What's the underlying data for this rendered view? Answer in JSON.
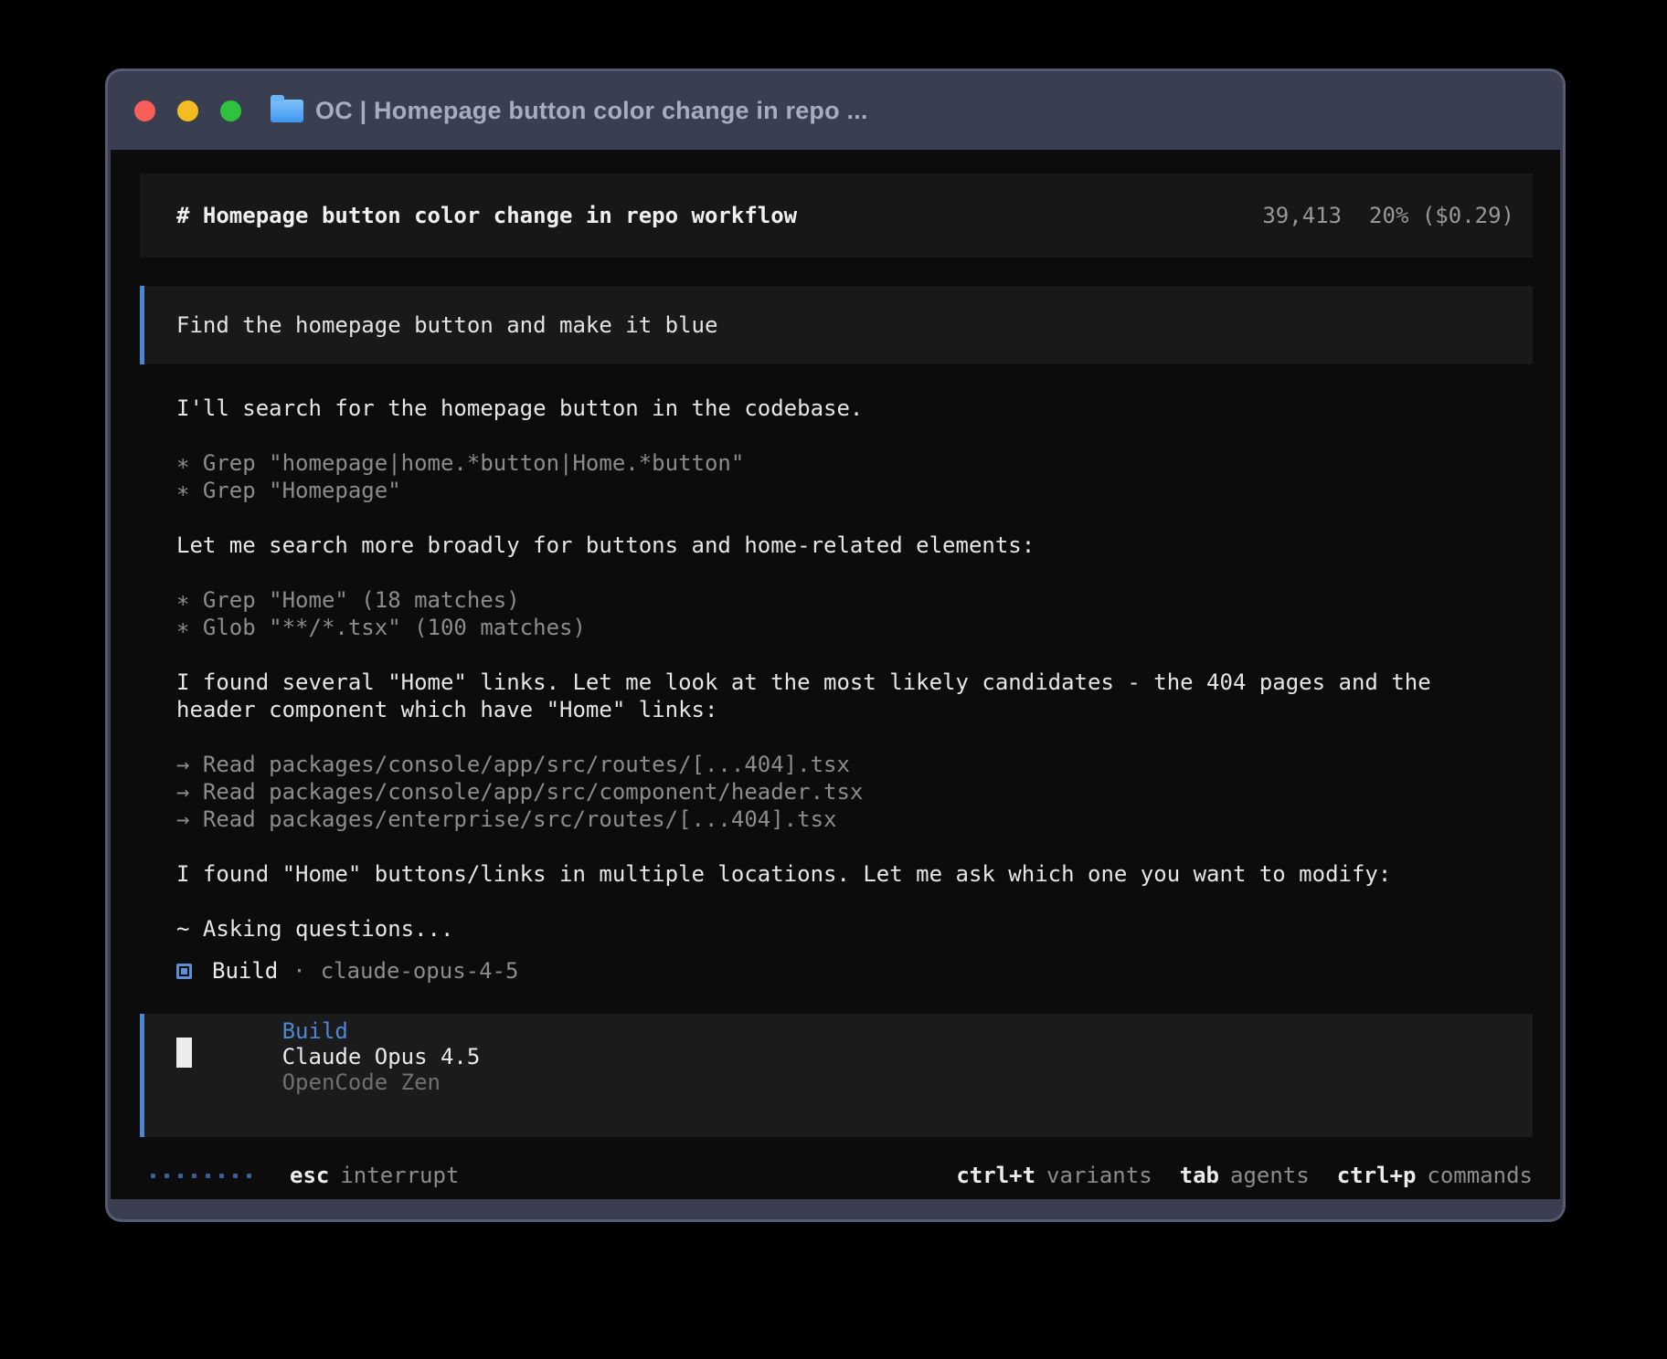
{
  "window": {
    "title": "OC | Homepage button color change in repo ..."
  },
  "header": {
    "title": "# Homepage button color change in repo workflow",
    "tokens": "39,413",
    "context": "20% ($0.29)"
  },
  "user_message": "Find the homepage button and make it blue",
  "conversation": [
    {
      "type": "text",
      "text": "I'll search for the homepage button in the codebase."
    },
    {
      "type": "blank"
    },
    {
      "type": "tool",
      "prefix": "∗",
      "text": "Grep \"homepage|home.*button|Home.*button\""
    },
    {
      "type": "tool",
      "prefix": "∗",
      "text": "Grep \"Homepage\""
    },
    {
      "type": "blank"
    },
    {
      "type": "text",
      "text": "Let me search more broadly for buttons and home-related elements:"
    },
    {
      "type": "blank"
    },
    {
      "type": "tool",
      "prefix": "∗",
      "text": "Grep \"Home\" (18 matches)"
    },
    {
      "type": "tool",
      "prefix": "∗",
      "text": "Glob \"**/*.tsx\" (100 matches)"
    },
    {
      "type": "blank"
    },
    {
      "type": "text",
      "text": "I found several \"Home\" links. Let me look at the most likely candidates - the 404 pages and the"
    },
    {
      "type": "text",
      "text": "header component which have \"Home\" links:"
    },
    {
      "type": "blank"
    },
    {
      "type": "tool",
      "prefix": "→",
      "text": "Read packages/console/app/src/routes/[...404].tsx"
    },
    {
      "type": "tool",
      "prefix": "→",
      "text": "Read packages/console/app/src/component/header.tsx"
    },
    {
      "type": "tool",
      "prefix": "→",
      "text": "Read packages/enterprise/src/routes/[...404].tsx"
    },
    {
      "type": "blank"
    },
    {
      "type": "text",
      "text": "I found \"Home\" buttons/links in multiple locations. Let me ask which one you want to modify:"
    },
    {
      "type": "blank"
    },
    {
      "type": "text",
      "text": "~ Asking questions..."
    }
  ],
  "agent_status": {
    "name": "Build",
    "separator": "·",
    "model": "claude-opus-4-5"
  },
  "input": {
    "mode": "Build",
    "model": "Claude Opus 4.5",
    "provider": "OpenCode Zen"
  },
  "statusbar": {
    "spinner_dots": 8,
    "esc_key": "esc",
    "esc_label": "interrupt",
    "right": [
      {
        "key": "ctrl+t",
        "label": "variants"
      },
      {
        "key": "tab",
        "label": "agents"
      },
      {
        "key": "ctrl+p",
        "label": "commands"
      }
    ]
  },
  "colors": {
    "accent_blue": "#4d87d4",
    "frame": "#393e50",
    "terminal_bg": "#0c0c0c",
    "panel_bg": "#171717",
    "text": "#e6e6e6",
    "dim_text": "#8c8c8c"
  }
}
